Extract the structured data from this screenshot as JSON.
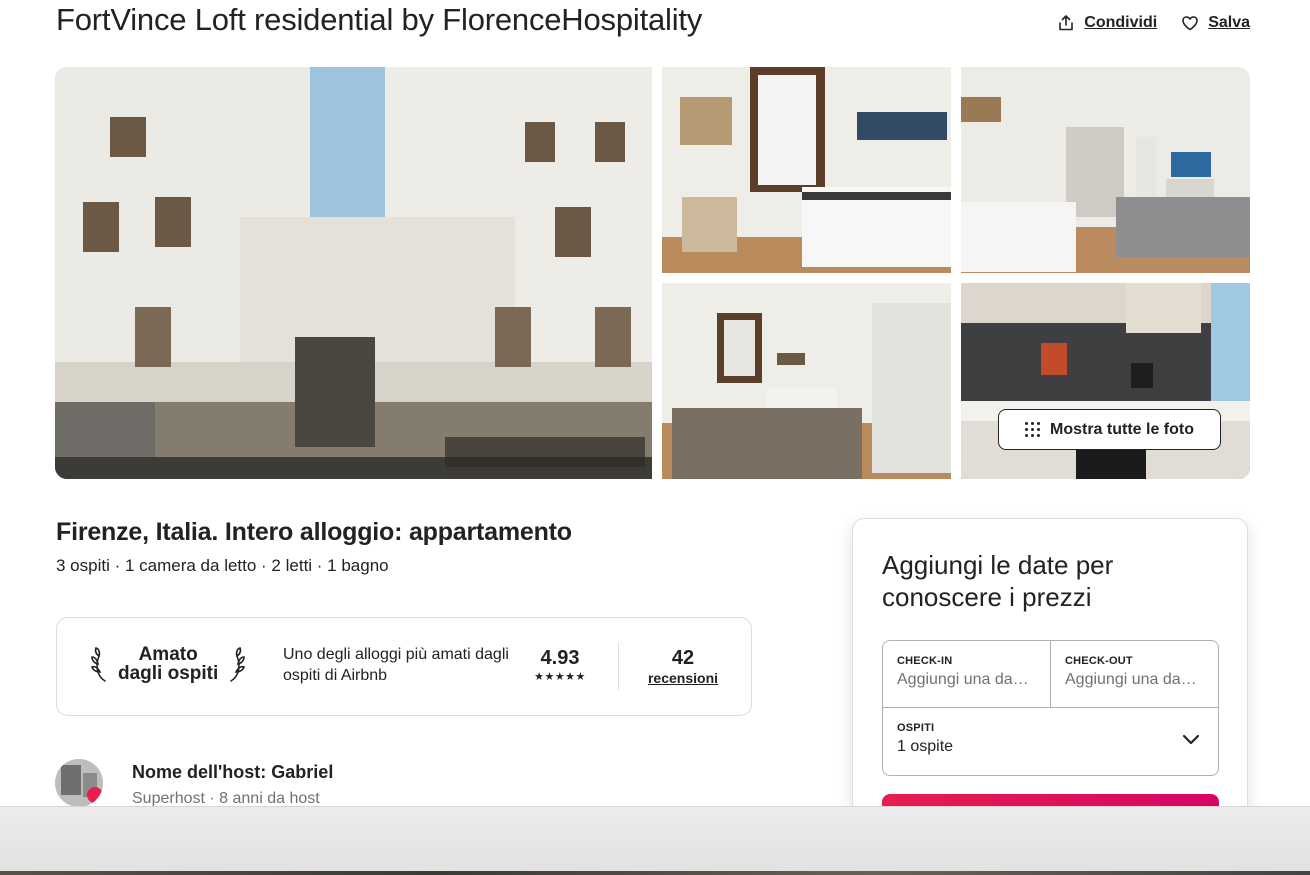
{
  "listing": {
    "title": "FortVince Loft residential by FlorenceHospitality",
    "share_label": "Condividi",
    "save_label": "Salva",
    "subtitle": "Firenze, Italia. Intero alloggio: appartamento",
    "details": "3 ospiti · 1 camera da letto · 2 letti · 1 bagno"
  },
  "gallery": {
    "show_all_label": "Mostra tutte le foto"
  },
  "guest_favorite": {
    "badge_line1": "Amato",
    "badge_line2": "dagli ospiti",
    "description": "Uno degli alloggi più amati dagli ospiti di Airbnb",
    "rating": "4.93",
    "stars": "★★★★★",
    "reviews_count": "42",
    "reviews_label": "recensioni"
  },
  "host": {
    "name": "Nome dell'host: Gabriel",
    "subtitle": "Superhost · 8 anni da host"
  },
  "booking": {
    "title": "Aggiungi le date per conoscere i prezzi",
    "checkin_label": "CHECK-IN",
    "checkin_value": "Aggiungi una da…",
    "checkout_label": "CHECK-OUT",
    "checkout_value": "Aggiungi una da…",
    "guests_label": "OSPITI",
    "guests_value": "1 ospite"
  },
  "colors": {
    "brand": "#e61e4d",
    "text": "#222222",
    "muted": "#717171",
    "border": "#dddddd"
  }
}
